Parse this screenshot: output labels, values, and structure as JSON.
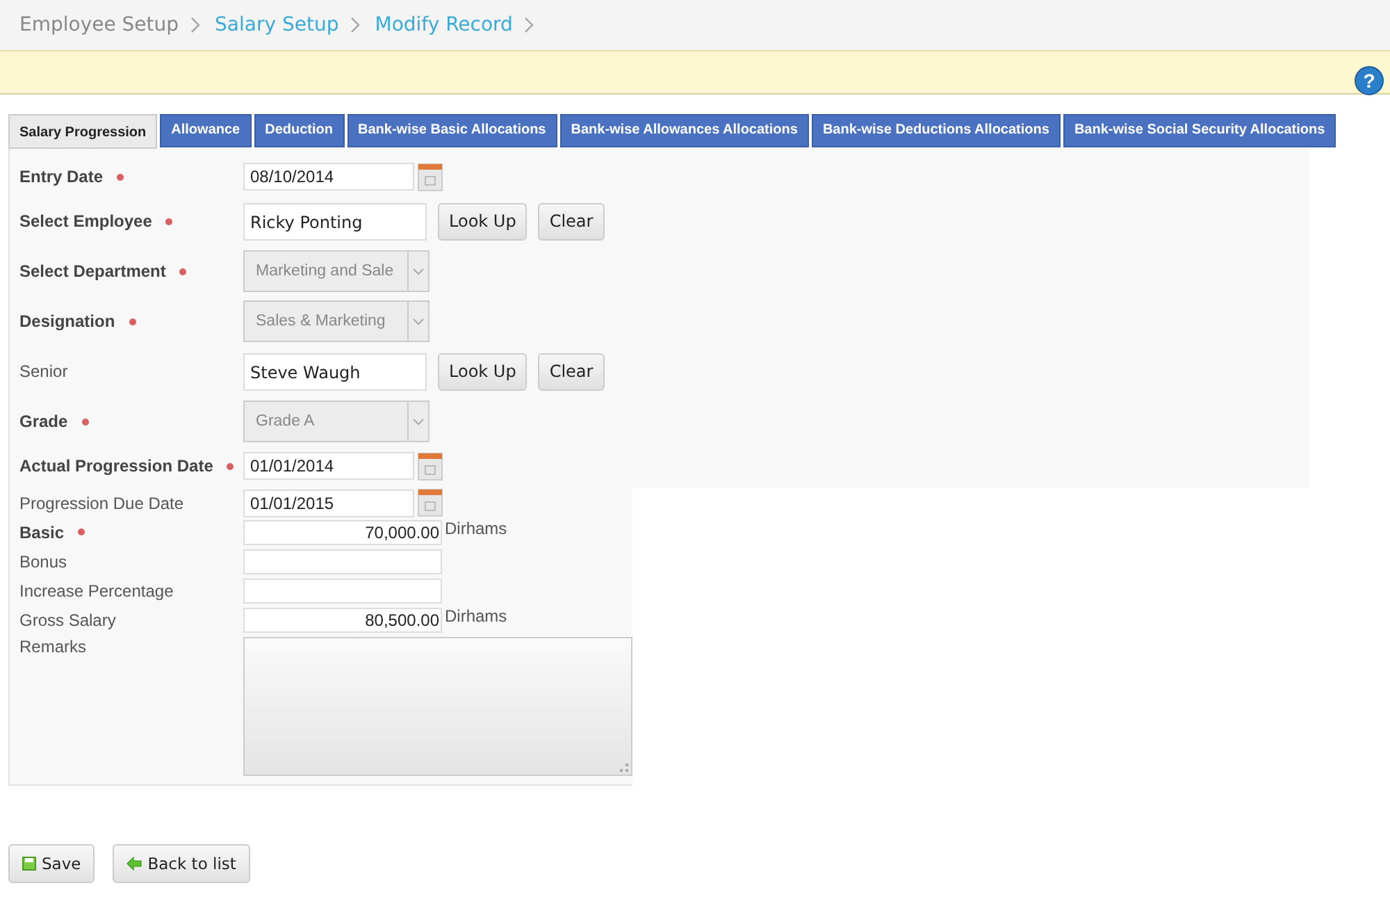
{
  "breadcrumb": [
    {
      "label": "Employee Setup",
      "current": false
    },
    {
      "label": "Salary Setup",
      "current": true
    },
    {
      "label": "Modify Record",
      "current": true
    }
  ],
  "help": "?",
  "tabs": [
    {
      "label": "Salary Progression",
      "selected": true
    },
    {
      "label": "Allowance",
      "selected": false
    },
    {
      "label": "Deduction",
      "selected": false
    },
    {
      "label": "Bank-wise Basic Allocations",
      "selected": false
    },
    {
      "label": "Bank-wise Allowances Allocations",
      "selected": false
    },
    {
      "label": "Bank-wise Deductions Allocations",
      "selected": false
    },
    {
      "label": "Bank-wise Social Security Allocations",
      "selected": false
    }
  ],
  "fields": [
    {
      "kind": "date",
      "label": "Entry Date",
      "required": true,
      "value": "08/10/2014"
    },
    {
      "kind": "lookup",
      "label": "Select Employee",
      "required": true,
      "value": "Ricky Ponting",
      "buttons": [
        "Look Up",
        "Clear"
      ]
    },
    {
      "kind": "select",
      "label": "Select Department",
      "required": true,
      "value": "Marketing and Sale"
    },
    {
      "kind": "select",
      "label": "Designation",
      "required": true,
      "value": "Sales & Marketing"
    },
    {
      "kind": "lookup",
      "label": "Senior",
      "required": false,
      "value": "Steve Waugh",
      "buttons": [
        "Look Up",
        "Clear"
      ]
    },
    {
      "kind": "select",
      "label": "Grade",
      "required": true,
      "value": "Grade A"
    },
    {
      "kind": "date",
      "label": "Actual Progression Date",
      "required": true,
      "value": "01/01/2014"
    },
    {
      "kind": "date",
      "label": "Progression Due Date",
      "required": false,
      "value": "01/01/2015"
    },
    {
      "kind": "amount",
      "label": "Basic",
      "required": true,
      "value": "70,000.00",
      "unit": "Dirhams"
    },
    {
      "kind": "amount",
      "label": "Bonus",
      "required": false
    },
    {
      "kind": "amount",
      "label": "Increase Percentage",
      "required": false
    },
    {
      "kind": "amount",
      "label": "Gross Salary",
      "required": false,
      "value": "80,500.00",
      "unit": "Dirhams"
    },
    {
      "kind": "textarea",
      "label": "Remarks",
      "required": false
    }
  ],
  "actions": [
    {
      "kind": "save",
      "label": "Save"
    },
    {
      "kind": "back",
      "label": "Back to list"
    }
  ]
}
